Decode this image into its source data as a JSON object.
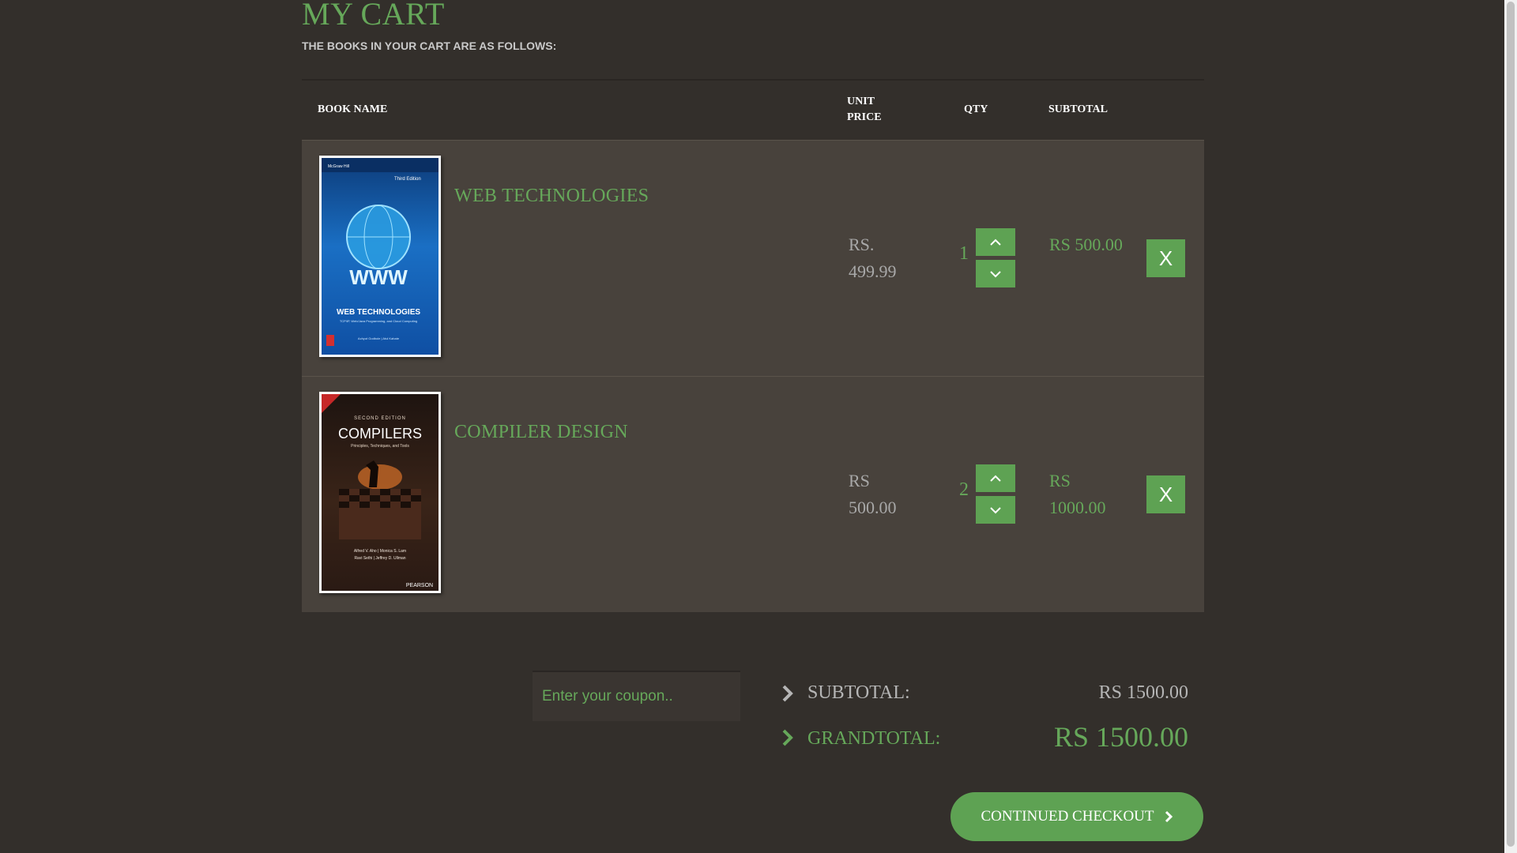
{
  "header": {
    "title": "MY CART",
    "subtitle": "THE BOOKS IN YOUR CART ARE AS FOLLOWS:"
  },
  "table": {
    "columns": {
      "book_name": "BOOK NAME",
      "unit_price": "UNIT PRICE",
      "qty": "QTY",
      "subtotal": "SUBTOTAL"
    },
    "rows": [
      {
        "name": "WEB TECHNOLOGIES",
        "price": "RS. 499.99",
        "qty": "1",
        "subtotal": "RS 500.00",
        "remove_label": "X",
        "cover": {
          "title": "WEB TECHNOLOGIES",
          "edition": "Third Edition",
          "tagline": "TCP/IP, Web/Java Programming, and Cloud Computing",
          "authors": "Achyut Godbole | Atul Kahate",
          "logo_text": "WWW",
          "color": "#1a6fc4"
        }
      },
      {
        "name": "COMPILER DESIGN",
        "price": "RS 500.00",
        "qty": "2",
        "subtotal": "RS 1000.00",
        "remove_label": "X",
        "cover": {
          "edition": "SECOND EDITION",
          "title": "COMPILERS",
          "tagline": "Principles, Techniques, and Tools",
          "authors_1": "Alfred V. Aho | Monica S. Lam",
          "authors_2": "Ravi Sethi | Jeffrey D. Ullman",
          "publisher": "PEARSON",
          "color": "#2a1a14"
        }
      }
    ]
  },
  "coupon": {
    "placeholder": "Enter your coupon.."
  },
  "summary": {
    "subtotal_label": "SUBTOTAL:",
    "subtotal_value": "RS 1500.00",
    "grandtotal_label": "GRANDTOTAL:",
    "grandtotal_value": "RS 1500.00"
  },
  "checkout": {
    "label": "CONTINUED CHECKOUT"
  },
  "colors": {
    "background": "#332f2b",
    "accent": "#5ea253",
    "row_bg": "#48423c"
  }
}
